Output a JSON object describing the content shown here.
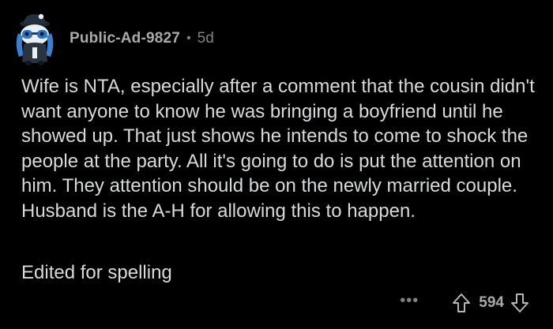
{
  "comment": {
    "username": "Public-Ad-9827",
    "separator": "•",
    "age": "5d",
    "body": "Wife is NTA, especially after a comment that the cousin didn't want anyone to know he was bringing a boyfriend until he showed up. That just shows he intends to come to shock the people at the party. All it's going to do is put the attention on him. They attention should be on the newly married couple. Husband is the A-H for allowing this to happen.",
    "edit_note": "Edited for spelling",
    "score": "594",
    "more_label": "•••"
  },
  "icons": {
    "avatar": "snoo-avatar",
    "upvote": "upvote-arrow-icon",
    "downvote": "downvote-arrow-icon",
    "more": "more-options-icon"
  },
  "colors": {
    "background": "#000000",
    "text": "#d7dadc",
    "meta": "#818384",
    "username": "#a8aaab",
    "avatar_blue": "#4a90d9"
  }
}
